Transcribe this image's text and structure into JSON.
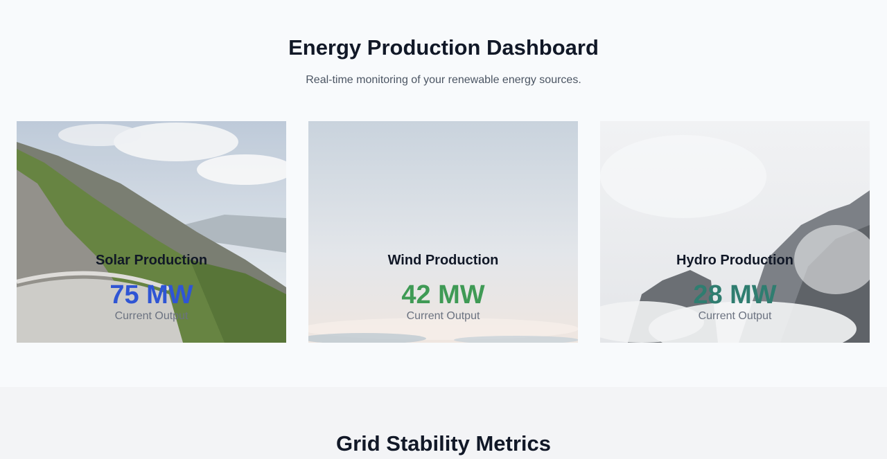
{
  "hero": {
    "title": "Energy Production Dashboard",
    "subtitle": "Real-time monitoring of your renewable energy sources."
  },
  "cards": [
    {
      "title": "Solar Production",
      "value": "75 MW",
      "label": "Current Output",
      "value_color": "#2f55d4",
      "image": "mountain-road-photo"
    },
    {
      "title": "Wind Production",
      "value": "42 MW",
      "label": "Current Output",
      "value_color": "#3f9a55",
      "image": "sky-clouds-photo"
    },
    {
      "title": "Hydro Production",
      "value": "28 MW",
      "label": "Current Output",
      "value_color": "#2f7d70",
      "image": "misty-mountain-photo"
    }
  ],
  "section2": {
    "title": "Grid Stability Metrics"
  }
}
